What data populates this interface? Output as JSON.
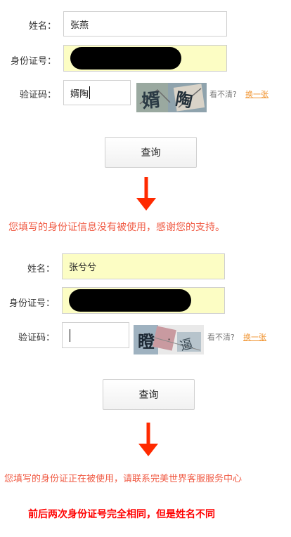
{
  "form1": {
    "name_label": "姓名：",
    "name_value": "张燕",
    "id_label": "身份证号：",
    "captcha_label": "验证码：",
    "captcha_value": "婿陶",
    "captcha_chars": [
      "婿",
      "陶"
    ],
    "hint": "看不清?",
    "refresh_link": "换一张",
    "submit": "查询"
  },
  "message1": "您填写的身份证信息没有被使用，感谢您的支持。",
  "form2": {
    "name_label": "姓名：",
    "name_value": "张兮兮",
    "id_label": "身份证号：",
    "captcha_label": "验证码：",
    "captcha_value": "",
    "captcha_chars": [
      "瞪",
      "·",
      "逼"
    ],
    "hint": "看不清?",
    "refresh_link": "换一张",
    "submit": "查询"
  },
  "message2": "您填写的身份证正在被使用，请联系完美世界客服服务中心",
  "footnote": "前后两次身份证号完全相同，但是姓名不同",
  "colors": {
    "highlight_field": "#fcfdc4",
    "arrow": "#ff2a00",
    "message": "#f05a43",
    "footnote": "#ff0000",
    "link": "#f0932f"
  }
}
